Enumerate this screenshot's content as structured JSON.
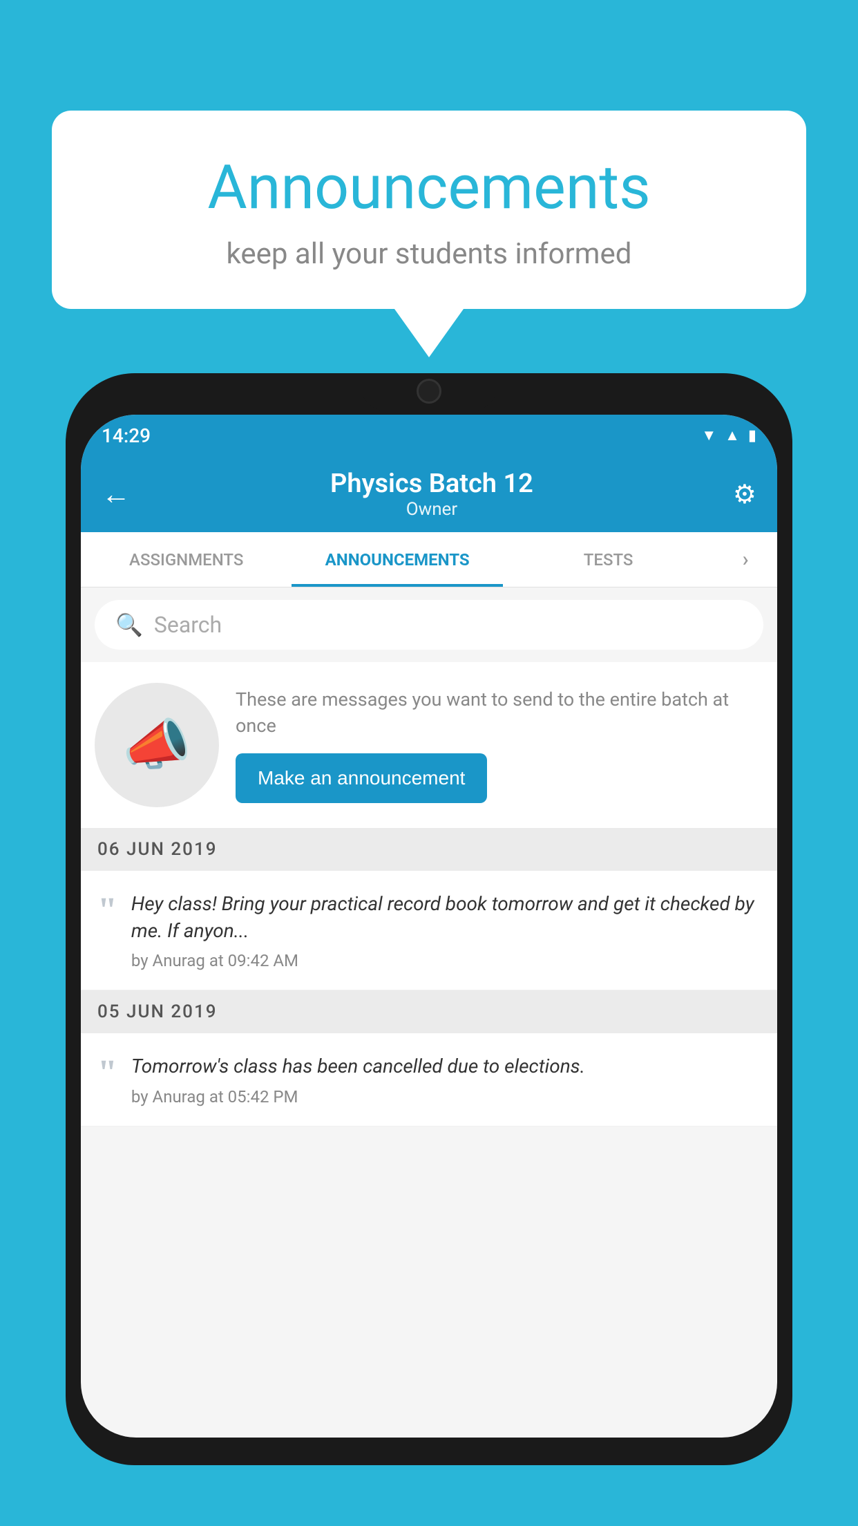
{
  "background": {
    "color": "#29b6d8"
  },
  "speech_bubble": {
    "title": "Announcements",
    "subtitle": "keep all your students informed"
  },
  "status_bar": {
    "time": "14:29",
    "icons": [
      "wifi",
      "signal",
      "battery"
    ]
  },
  "header": {
    "back_label": "←",
    "title": "Physics Batch 12",
    "subtitle": "Owner",
    "gear_label": "⚙"
  },
  "tabs": [
    {
      "label": "ASSIGNMENTS",
      "active": false
    },
    {
      "label": "ANNOUNCEMENTS",
      "active": true
    },
    {
      "label": "TESTS",
      "active": false
    },
    {
      "label": "...",
      "active": false
    }
  ],
  "search": {
    "placeholder": "Search"
  },
  "announcement_prompt": {
    "description": "These are messages you want to send to the entire batch at once",
    "button_label": "Make an announcement"
  },
  "announcements": [
    {
      "date": "06  JUN  2019",
      "items": [
        {
          "message": "Hey class! Bring your practical record book tomorrow and get it checked by me. If anyon...",
          "meta": "by Anurag at 09:42 AM"
        }
      ]
    },
    {
      "date": "05  JUN  2019",
      "items": [
        {
          "message": "Tomorrow's class has been cancelled due to elections.",
          "meta": "by Anurag at 05:42 PM"
        }
      ]
    }
  ]
}
